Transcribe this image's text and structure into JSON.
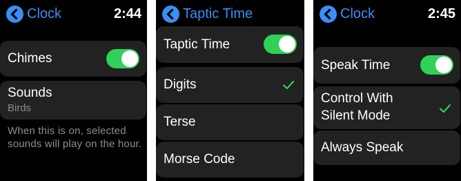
{
  "screens": [
    {
      "header": {
        "title": "Clock",
        "time": "2:44"
      },
      "chimes": {
        "label": "Chimes",
        "on": true
      },
      "sounds": {
        "label": "Sounds",
        "value": "Birds"
      },
      "note": "When this is on, selected sounds will play on the hour."
    },
    {
      "header": {
        "title": "Taptic Time"
      },
      "taptic_toggle": {
        "label": "Taptic Time",
        "on": true
      },
      "options": [
        {
          "label": "Digits",
          "selected": true
        },
        {
          "label": "Terse",
          "selected": false
        },
        {
          "label": "Morse Code",
          "selected": false
        }
      ]
    },
    {
      "header": {
        "title": "Clock",
        "time": "2:45"
      },
      "speak_toggle": {
        "label": "Speak Time",
        "on": true
      },
      "options": [
        {
          "label_line1": "Control With",
          "label_line2": "Silent Mode",
          "selected": true
        },
        {
          "label": "Always Speak",
          "selected": false
        }
      ]
    }
  ],
  "colors": {
    "accent": "#3a8ef6",
    "toggle_on": "#30d158",
    "row_bg": "#222222",
    "secondary_text": "#8e8e93"
  },
  "icons": {
    "back": "chevron-left-icon",
    "check": "checkmark-icon"
  }
}
